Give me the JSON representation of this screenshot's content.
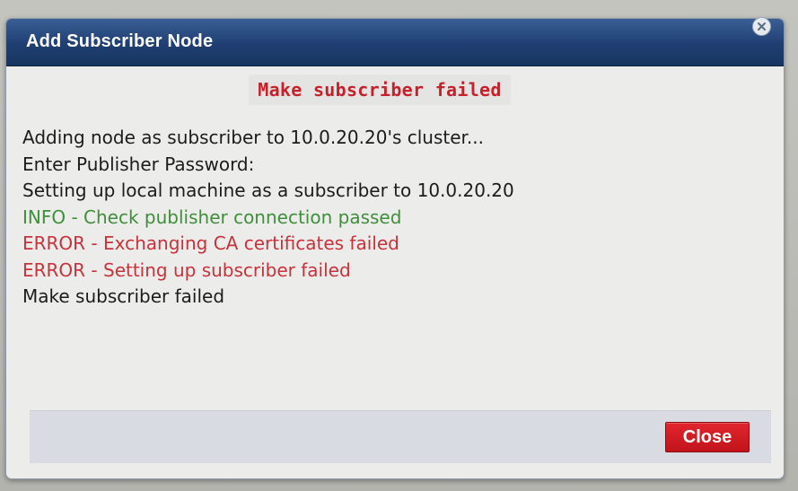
{
  "dialog": {
    "title": "Add Subscriber Node",
    "close_icon": "close-icon",
    "status_banner": "Make subscriber failed",
    "log_lines": [
      {
        "text": "Adding node as subscriber to 10.0.20.20's cluster...",
        "level": "normal"
      },
      {
        "text": "Enter Publisher Password:",
        "level": "normal"
      },
      {
        "text": "Setting up local machine as a subscriber to 10.0.20.20",
        "level": "normal"
      },
      {
        "text": "INFO - Check publisher connection passed",
        "level": "info"
      },
      {
        "text": "ERROR - Exchanging CA certificates failed",
        "level": "error"
      },
      {
        "text": "ERROR - Setting up subscriber failed",
        "level": "error"
      },
      {
        "text": "Make subscriber failed",
        "level": "normal"
      }
    ],
    "close_button_label": "Close"
  },
  "colors": {
    "titlebar": "#1f3f72",
    "error": "#c8323a",
    "info": "#3f8f3a",
    "button": "#d11b23"
  }
}
